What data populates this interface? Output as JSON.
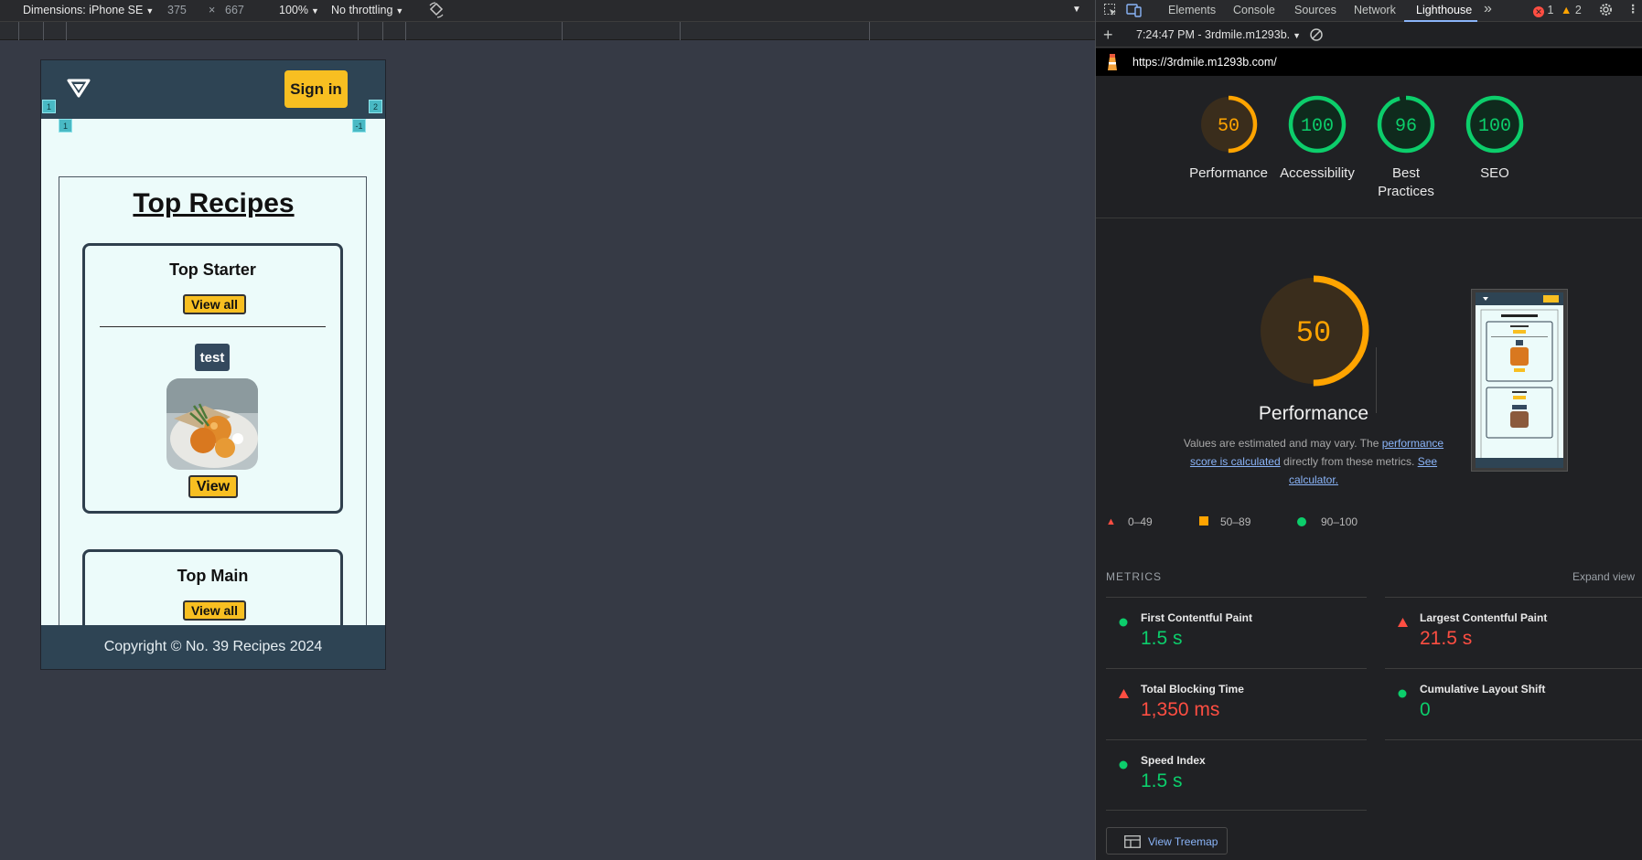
{
  "emulation": {
    "dimensions_label": "Dimensions: iPhone SE",
    "width": "375",
    "times": "×",
    "height": "667",
    "zoom": "100%",
    "throttling": "No throttling"
  },
  "site": {
    "signin": "Sign in",
    "badges": [
      "1",
      "2",
      "1",
      "-1"
    ],
    "title": "Top Recipes",
    "cards": [
      {
        "title": "Top Starter",
        "view_all": "View all",
        "tag": "test",
        "view": "View"
      },
      {
        "title": "Top Main",
        "view_all": "View all"
      }
    ],
    "footer": "Copyright © No. 39 Recipes 2024"
  },
  "devtools": {
    "tabs": [
      "Elements",
      "Console",
      "Sources",
      "Network",
      "Lighthouse"
    ],
    "more": "»",
    "errors": "1",
    "warnings": "2",
    "report_selector": "7:24:47 PM - 3rdmile.m1293b.",
    "url": "https://3rdmile.m1293b.com/",
    "scores": [
      {
        "value": "50",
        "label": "Performance",
        "color": "#ffa400",
        "fraction": 0.5
      },
      {
        "value": "100",
        "label": "Accessibility",
        "color": "#0cce6b",
        "fraction": 1.0
      },
      {
        "value": "96",
        "label": "Best Practices",
        "color": "#0cce6b",
        "fraction": 0.96
      },
      {
        "value": "100",
        "label": "SEO",
        "color": "#0cce6b",
        "fraction": 1.0
      }
    ],
    "big_score": {
      "value": "50",
      "label": "Performance"
    },
    "desc_prefix": "Values are estimated and may vary. The ",
    "desc_link1": "performance score is calculated",
    "desc_mid": " directly from these metrics. ",
    "desc_link2": "See calculator.",
    "legend": {
      "fail": "0–49",
      "average": "50–89",
      "pass": "90–100"
    },
    "metrics_heading": "METRICS",
    "expand_view": "Expand view",
    "metrics": [
      {
        "name": "First Contentful Paint",
        "value": "1.5 s",
        "status": "pass"
      },
      {
        "name": "Largest Contentful Paint",
        "value": "21.5 s",
        "status": "fail"
      },
      {
        "name": "Total Blocking Time",
        "value": "1,350 ms",
        "status": "fail"
      },
      {
        "name": "Cumulative Layout Shift",
        "value": "0",
        "status": "pass"
      },
      {
        "name": "Speed Index",
        "value": "1.5 s",
        "status": "pass"
      }
    ],
    "view_treemap": "View Treemap",
    "colors": {
      "pass": "#0cce6b",
      "average": "#ffa400",
      "fail": "#ff4e42",
      "link": "#8ab4f8"
    }
  }
}
